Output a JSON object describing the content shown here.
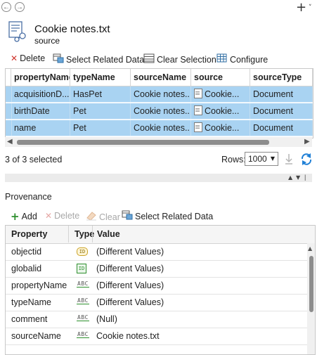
{
  "nav": {
    "back": "←",
    "forward": "→",
    "add": "+",
    "menu_chevron": "˅"
  },
  "header": {
    "title": "Cookie notes.txt",
    "subtitle": "source",
    "icon": "document-link-icon"
  },
  "toolbar": {
    "delete_label": "Delete",
    "select_related_label": "Select Related Data",
    "clear_selection_label": "Clear Selection",
    "configure_label": "Configure"
  },
  "table": {
    "columns": [
      "propertyName",
      "typeName",
      "sourceName",
      "source",
      "sourceType"
    ],
    "rows": [
      {
        "propertyName": "acquisitionD...",
        "typeName": "HasPet",
        "sourceName": "Cookie notes...",
        "source": "Cookie...",
        "sourceType": "Document"
      },
      {
        "propertyName": "birthDate",
        "typeName": "Pet",
        "sourceName": "Cookie notes...",
        "source": "Cookie...",
        "sourceType": "Document"
      },
      {
        "propertyName": "name",
        "typeName": "Pet",
        "sourceName": "Cookie notes...",
        "source": "Cookie...",
        "sourceType": "Document"
      }
    ]
  },
  "status": {
    "selected_text": "3 of 3 selected",
    "rows_label": "Rows:",
    "rows_value": "1000"
  },
  "provenance": {
    "section_label": "Provenance",
    "toolbar": {
      "add_label": "Add",
      "delete_label": "Delete",
      "clear_label": "Clear",
      "select_related_label": "Select Related Data"
    },
    "columns": [
      "Property",
      "Type",
      "Value"
    ],
    "rows": [
      {
        "property": "objectid",
        "type_icon": "object-id-icon",
        "type_text": "ID",
        "value": "(Different Values)"
      },
      {
        "property": "globalid",
        "type_icon": "global-id-icon",
        "type_text": "ID",
        "value": "(Different Values)"
      },
      {
        "property": "propertyName",
        "type_icon": "text-type-icon",
        "type_text": "ABC",
        "value": "(Different Values)"
      },
      {
        "property": "typeName",
        "type_icon": "text-type-icon",
        "type_text": "ABC",
        "value": "(Different Values)"
      },
      {
        "property": "comment",
        "type_icon": "text-type-icon",
        "type_text": "ABC",
        "value": "(Null)"
      },
      {
        "property": "sourceName",
        "type_icon": "text-type-icon",
        "type_text": "ABC",
        "value": "Cookie notes.txt"
      }
    ]
  },
  "colors": {
    "selection": "#a9d3f2",
    "accent": "#2d8f2d",
    "delete": "#d0342c"
  }
}
